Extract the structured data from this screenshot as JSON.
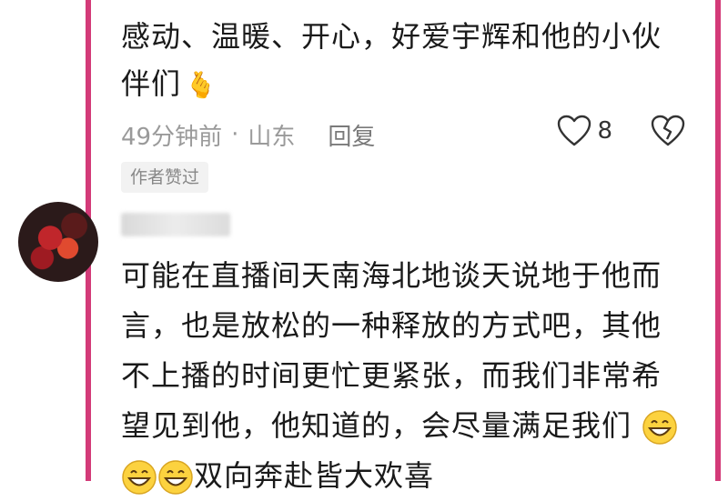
{
  "comment1": {
    "text_line1": "感动、温暖、开心，好爱宇辉和他的小伙",
    "text_line2": "伴们",
    "emoji": "🫰",
    "time": "49分钟前",
    "separator": "·",
    "location": "山东",
    "reply_label": "回复",
    "like_count": "8",
    "author_badge": "作者赞过"
  },
  "comment2": {
    "text_line1": "可能在直播间天南海北地谈天说地于他而",
    "text_line2": "言，也是放松的一种释放的方式吧，其他",
    "text_line3": "不上播的时间更忙更紧张，而我们非常希",
    "text_line4": "望见到他，他知道的，会尽量满足我们",
    "text_line5": "双向奔赴皆大欢喜"
  },
  "colors": {
    "frame": "#d33a78",
    "meta_text": "#9a9a9a",
    "body_text": "#1a1a1a"
  }
}
